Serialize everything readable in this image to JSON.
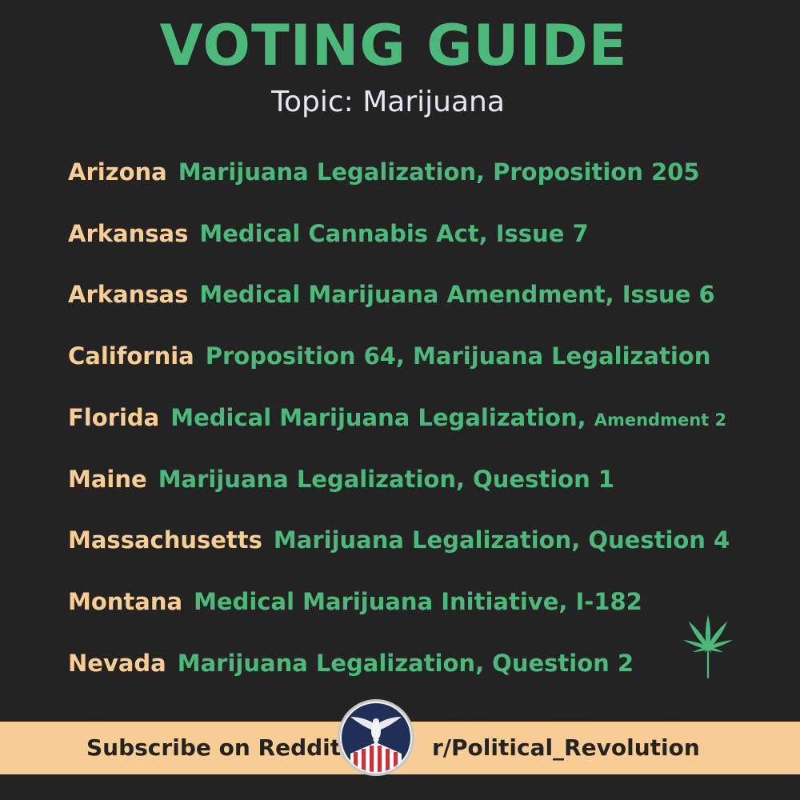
{
  "title": "VOTING GUIDE",
  "subtitle": "Topic: Marijuana",
  "measures": [
    {
      "state": "Arizona",
      "measure": "Marijuana Legalization, Proposition 205",
      "suffix": ""
    },
    {
      "state": "Arkansas",
      "measure": "Medical Cannabis Act, Issue 7",
      "suffix": ""
    },
    {
      "state": "Arkansas",
      "measure": "Medical Marijuana Amendment, Issue 6",
      "suffix": ""
    },
    {
      "state": "California",
      "measure": "Proposition 64, Marijuana Legalization",
      "suffix": ""
    },
    {
      "state": "Florida",
      "measure": "Medical Marijuana Legalization,",
      "suffix": "Amendment 2"
    },
    {
      "state": "Maine",
      "measure": "Marijuana Legalization, Question 1",
      "suffix": ""
    },
    {
      "state": "Massachusetts",
      "measure": "Marijuana Legalization, Question 4",
      "suffix": ""
    },
    {
      "state": "Montana",
      "measure": "Medical Marijuana Initiative, I-182",
      "suffix": ""
    },
    {
      "state": "Nevada",
      "measure": "Marijuana Legalization, Question 2",
      "suffix": ""
    }
  ],
  "footer": {
    "left_text": "Subscribe on Reddit",
    "right_text": "r/Political_Revolution"
  },
  "icons": {
    "leaf": "cannabis-leaf-icon",
    "badge": "eagle-flag-badge-icon"
  },
  "colors": {
    "background": "#232323",
    "green": "#4cb97a",
    "peach": "#f7cd95",
    "subtitle": "#e4e6f4"
  }
}
